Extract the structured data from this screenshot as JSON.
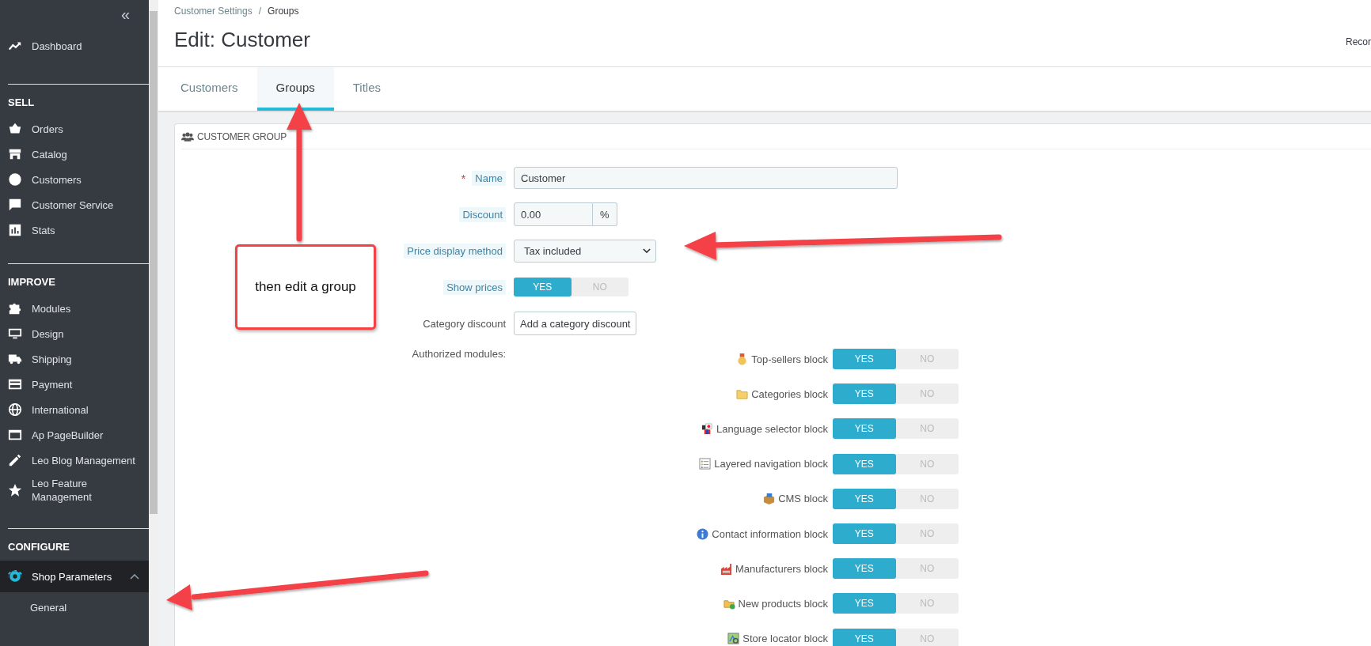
{
  "sidebar": {
    "collapse_label": "«",
    "dashboard": "Dashboard",
    "sections": [
      {
        "title": "SELL",
        "items": [
          {
            "label": "Orders",
            "selected": false,
            "expanded": false
          },
          {
            "label": "Catalog",
            "selected": false,
            "expanded": false
          },
          {
            "label": "Customers",
            "selected": false,
            "expanded": false
          },
          {
            "label": "Customer Service",
            "selected": false,
            "expanded": false
          },
          {
            "label": "Stats",
            "selected": false,
            "expanded": false
          }
        ]
      },
      {
        "title": "IMPROVE",
        "items": [
          {
            "label": "Modules",
            "selected": false,
            "expanded": false
          },
          {
            "label": "Design",
            "selected": false,
            "expanded": false
          },
          {
            "label": "Shipping",
            "selected": false,
            "expanded": false
          },
          {
            "label": "Payment",
            "selected": false,
            "expanded": false
          },
          {
            "label": "International",
            "selected": false,
            "expanded": false
          },
          {
            "label": "Ap PageBuilder",
            "selected": false,
            "expanded": false
          },
          {
            "label": "Leo Blog Management",
            "selected": false,
            "expanded": false
          },
          {
            "label": "Leo Feature Management",
            "selected": false,
            "expanded": false
          }
        ]
      },
      {
        "title": "CONFIGURE",
        "items": [
          {
            "label": "Shop Parameters",
            "selected": true,
            "expanded": true,
            "children": [
              {
                "label": "General"
              }
            ]
          }
        ]
      }
    ]
  },
  "breadcrumb": [
    "Customer Settings",
    "Groups"
  ],
  "breadcrumb_separator": "/",
  "page_title": "Edit: Customer",
  "toolbar_text": "Recor",
  "tabs": [
    {
      "label": "Customers",
      "selected": false
    },
    {
      "label": "Groups",
      "selected": true
    },
    {
      "label": "Titles",
      "selected": false
    }
  ],
  "panel": {
    "title": "CUSTOMER GROUP",
    "name": {
      "label": "Name",
      "required_mark": "*",
      "value": "Customer"
    },
    "discount": {
      "label": "Discount",
      "value": "0.00",
      "unit": "%"
    },
    "price_display": {
      "label": "Price display method",
      "value": "Tax included"
    },
    "show_prices": {
      "label": "Show prices",
      "yes": "YES",
      "no": "NO",
      "on": true
    },
    "category_discount": {
      "label": "Category discount",
      "button": "Add a category discount"
    },
    "modules_label": "Authorized modules:",
    "modules": [
      {
        "label": "Top-sellers block",
        "yes": "YES",
        "no": "NO",
        "on": true
      },
      {
        "label": "Categories block",
        "yes": "YES",
        "no": "NO",
        "on": true
      },
      {
        "label": "Language selector block",
        "yes": "YES",
        "no": "NO",
        "on": true
      },
      {
        "label": "Layered navigation block",
        "yes": "YES",
        "no": "NO",
        "on": true
      },
      {
        "label": "CMS block",
        "yes": "YES",
        "no": "NO",
        "on": true
      },
      {
        "label": "Contact information block",
        "yes": "YES",
        "no": "NO",
        "on": true
      },
      {
        "label": "Manufacturers block",
        "yes": "YES",
        "no": "NO",
        "on": true
      },
      {
        "label": "New products block",
        "yes": "YES",
        "no": "NO",
        "on": true
      },
      {
        "label": "Store locator block",
        "yes": "YES",
        "no": "NO",
        "on": true
      }
    ]
  },
  "annotation": {
    "text": "then edit a group"
  }
}
